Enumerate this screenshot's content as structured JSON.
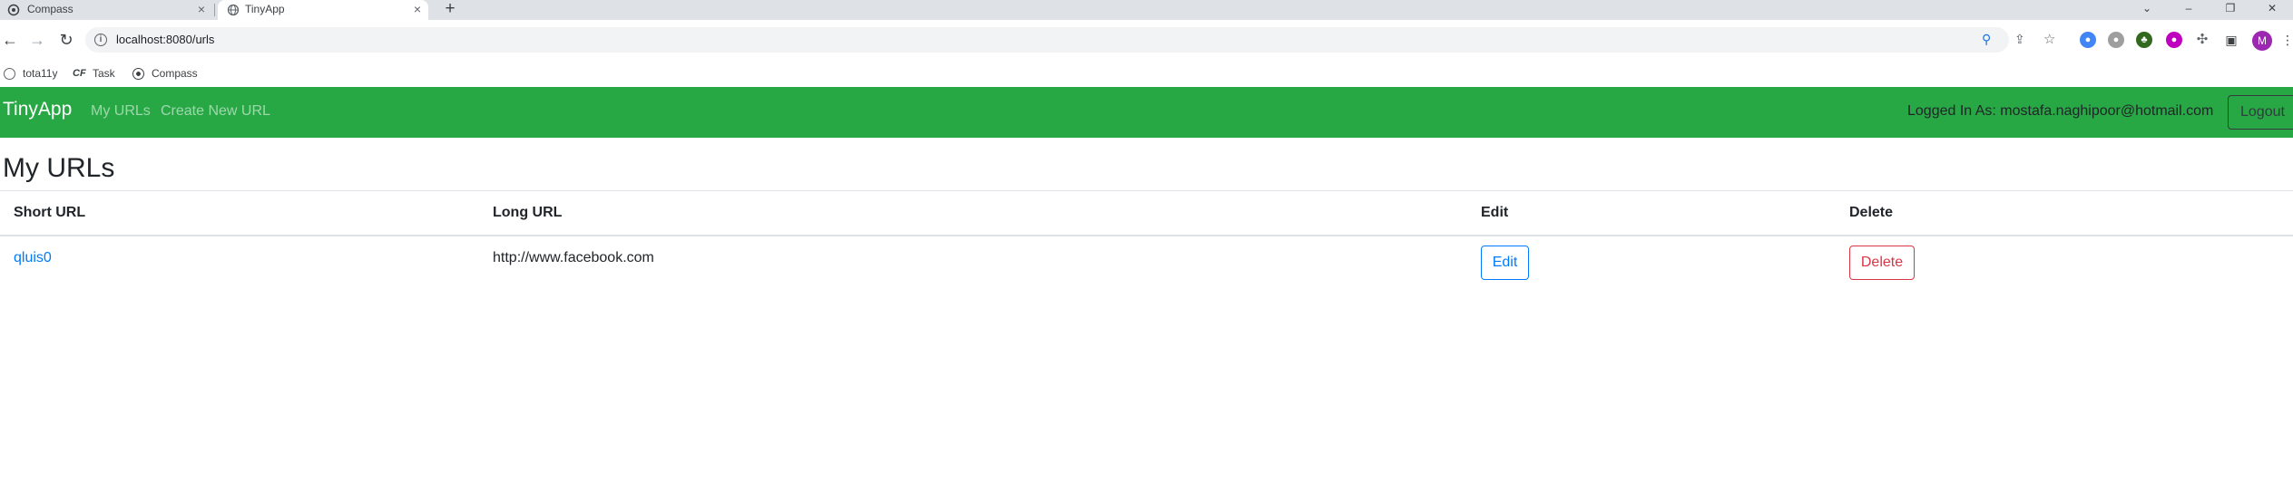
{
  "browser": {
    "tabs": [
      {
        "title": "Compass",
        "active": false
      },
      {
        "title": "TinyApp",
        "active": true
      }
    ],
    "new_tab_icon": "+",
    "address": "localhost:8080/urls",
    "bookmarks": [
      {
        "label": "tota11y"
      },
      {
        "label": "Task"
      },
      {
        "label": "Compass"
      }
    ],
    "profile_initial": "M"
  },
  "navbar": {
    "brand": "TinyApp",
    "links": [
      "My URLs",
      "Create New URL"
    ],
    "login_text": "Logged In As: mostafa.naghipoor@hotmail.com",
    "logout_label": "Logout",
    "color": "#28a745"
  },
  "main": {
    "title": "My URLs",
    "table": {
      "headers": [
        "Short URL",
        "Long URL",
        "Edit",
        "Delete"
      ],
      "rows": [
        {
          "short_url": "qluis0",
          "long_url": "http://www.facebook.com",
          "edit_label": "Edit",
          "delete_label": "Delete"
        }
      ]
    }
  }
}
